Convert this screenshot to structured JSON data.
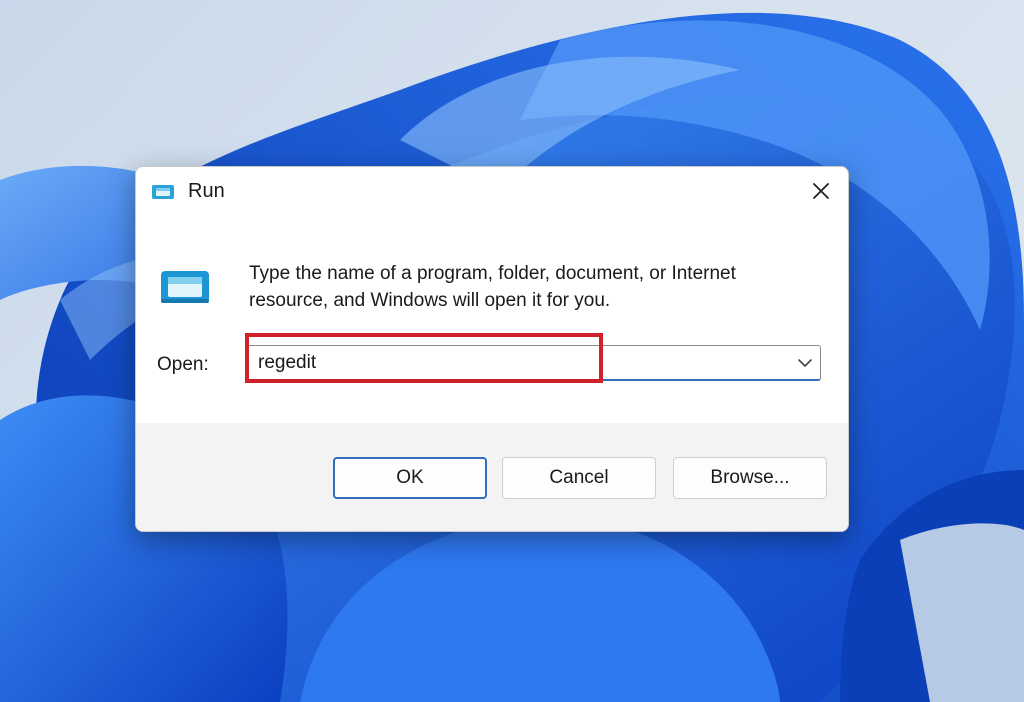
{
  "dialog": {
    "title": "Run",
    "title_icon": "run-icon",
    "close_icon": "close-icon",
    "big_icon": "run-icon",
    "description_line1": "Type the name of a program, folder, document, or Internet",
    "description_line2": "resource, and Windows will open it for you.",
    "open_label": "Open:",
    "open_value": "regedit",
    "dropdown_icon": "chevron-down-icon",
    "highlight_color": "#d0202a"
  },
  "buttons": {
    "ok": "OK",
    "cancel": "Cancel",
    "browse": "Browse..."
  },
  "colors": {
    "accent": "#2f6fba",
    "wallpaper_blue": "#1a5fe0",
    "wallpaper_bg": "#d6e1ee"
  }
}
